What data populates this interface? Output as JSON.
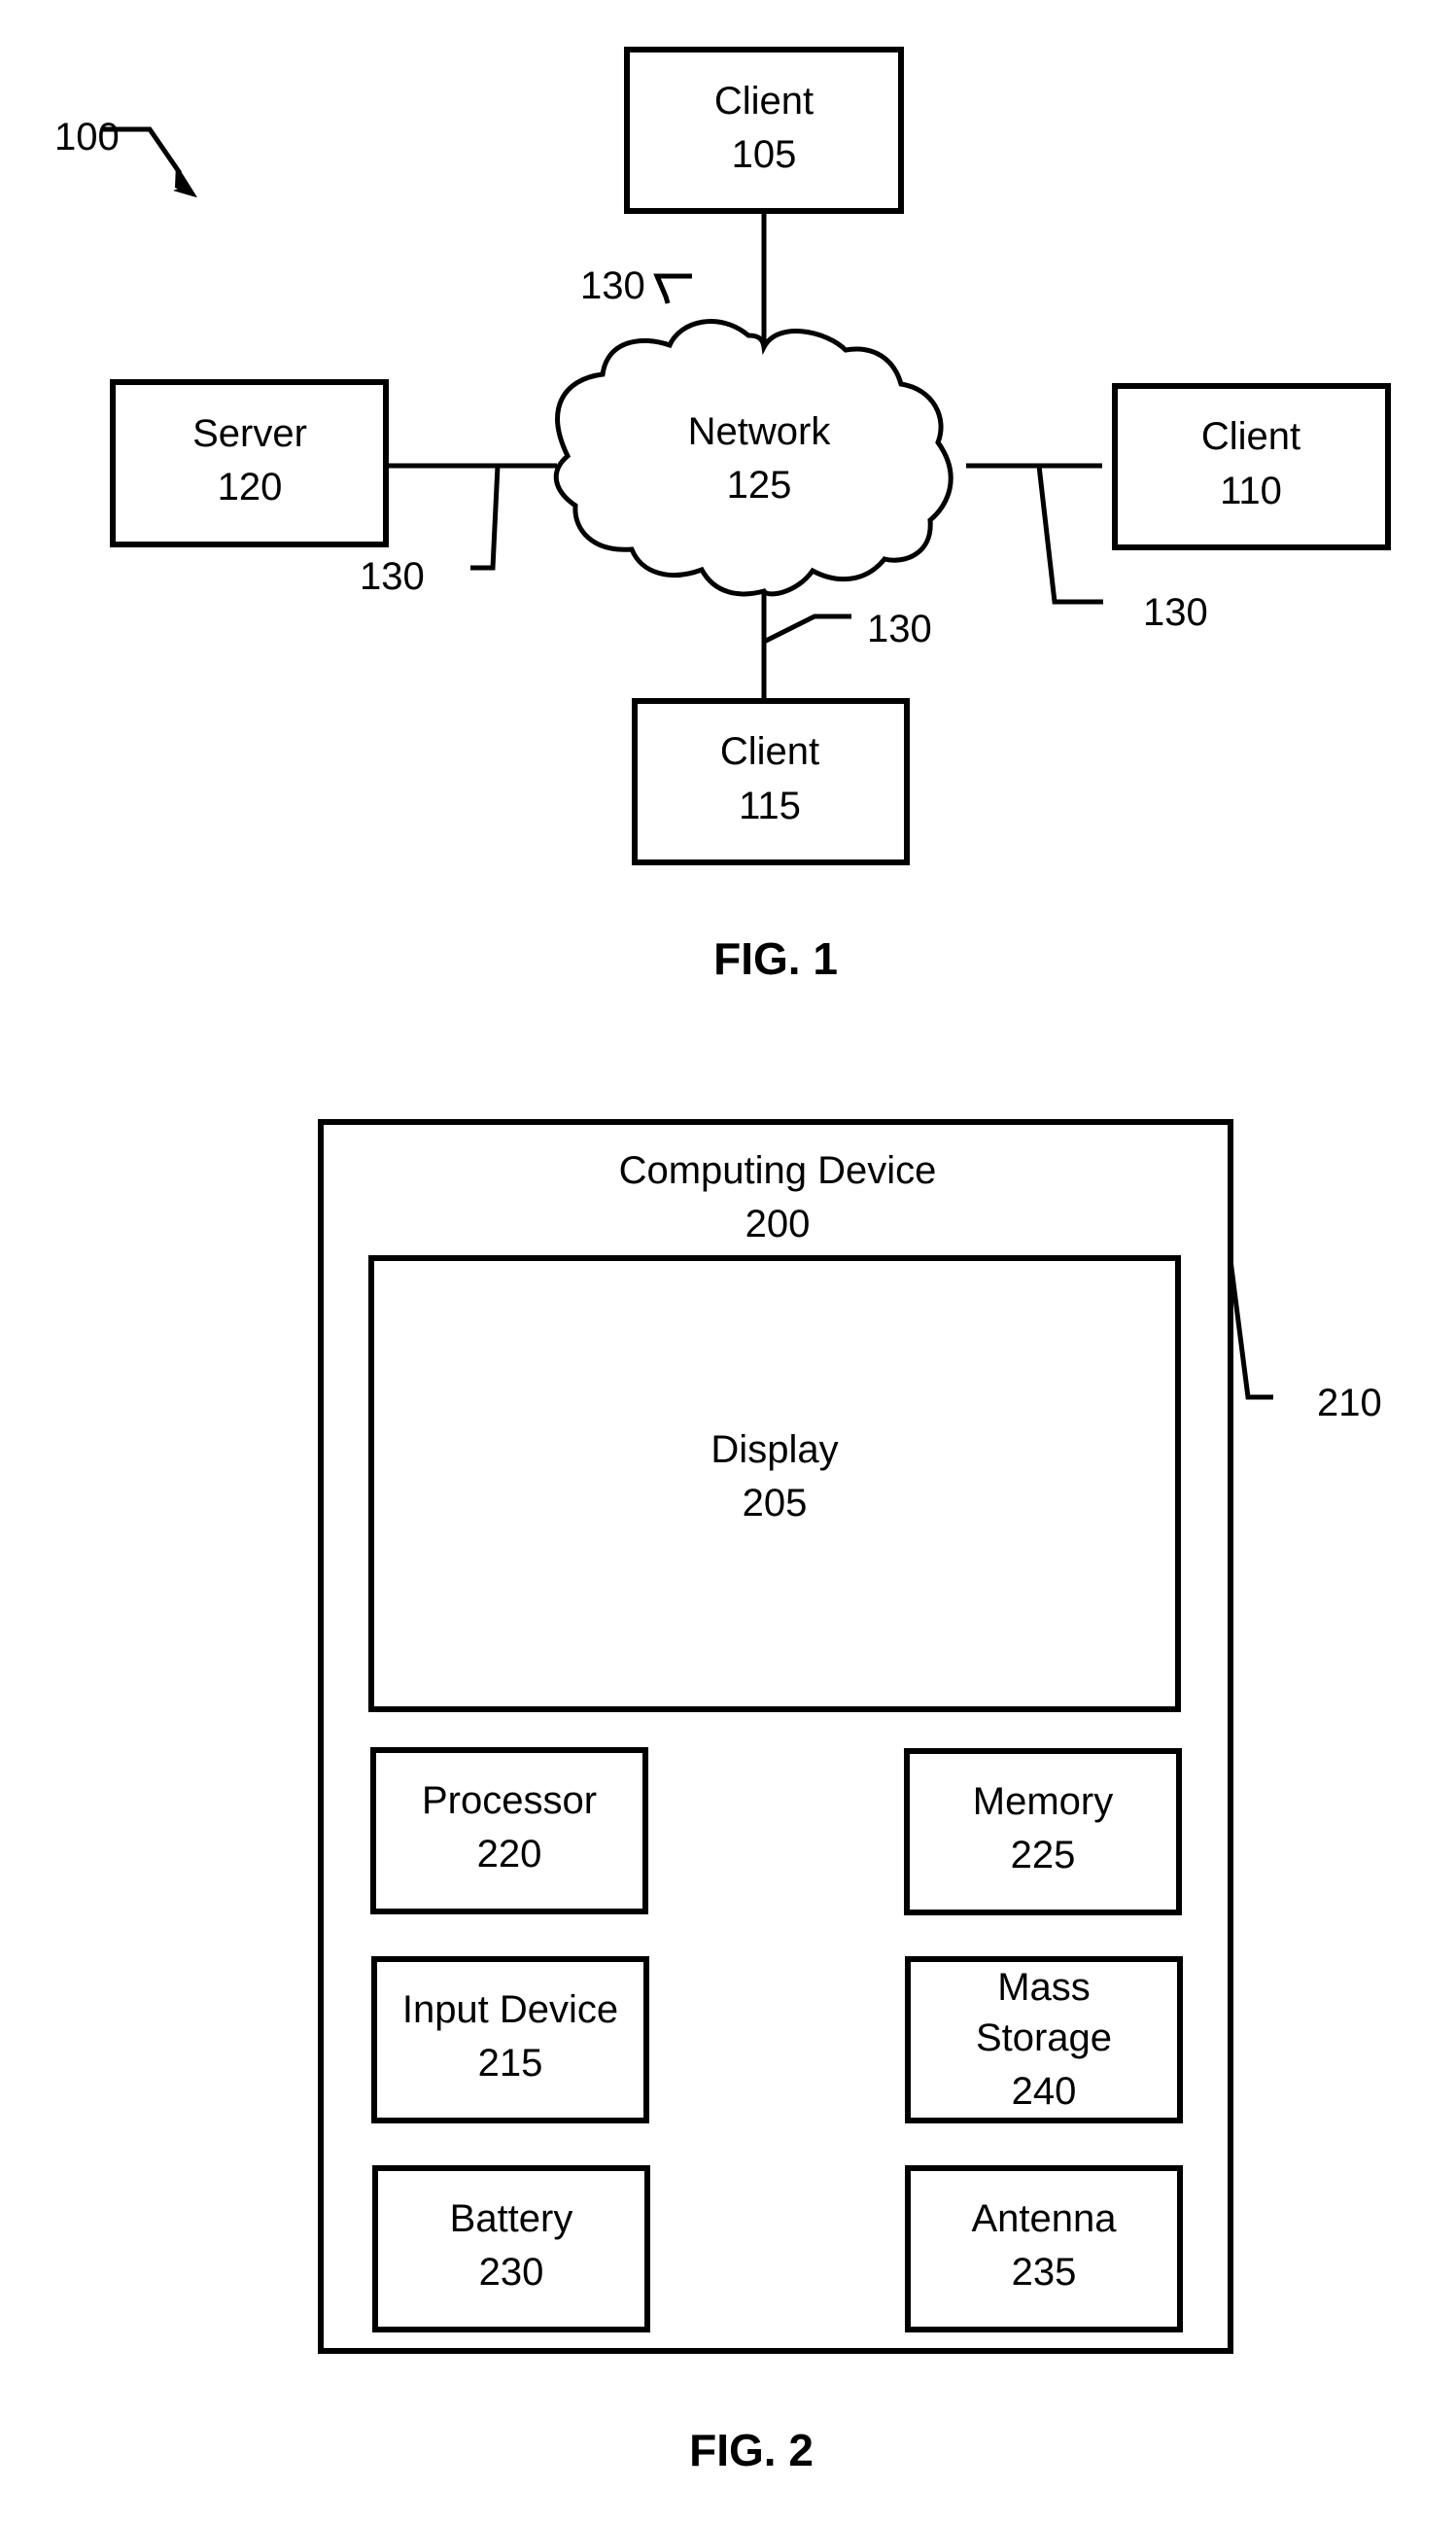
{
  "figure1": {
    "caption": "FIG. 1",
    "system_ref": "100",
    "link_ref": "130",
    "nodes": {
      "client_top": {
        "name": "Client",
        "ref": "105"
      },
      "client_right": {
        "name": "Client",
        "ref": "110"
      },
      "client_bottom": {
        "name": "Client",
        "ref": "115"
      },
      "server": {
        "name": "Server",
        "ref": "120"
      },
      "network": {
        "name": "Network",
        "ref": "125"
      }
    }
  },
  "figure2": {
    "caption": "FIG. 2",
    "device": {
      "name": "Computing Device",
      "ref": "200"
    },
    "housing_ref": "210",
    "display": {
      "name": "Display",
      "ref": "205"
    },
    "components": {
      "processor": {
        "name": "Processor",
        "ref": "220"
      },
      "memory": {
        "name": "Memory",
        "ref": "225"
      },
      "input_device": {
        "name": "Input Device",
        "ref": "215"
      },
      "mass_storage": {
        "line1": "Mass",
        "line2": "Storage",
        "ref": "240"
      },
      "battery": {
        "name": "Battery",
        "ref": "230"
      },
      "antenna": {
        "name": "Antenna",
        "ref": "235"
      }
    }
  }
}
